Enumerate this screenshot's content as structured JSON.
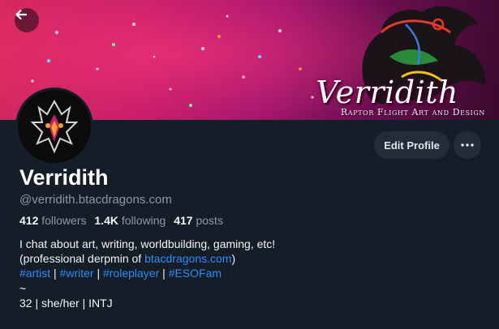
{
  "banner": {
    "title": "Verridith",
    "subtitle": "Raptor Flight Art and Design"
  },
  "buttons": {
    "edit_profile": "Edit Profile"
  },
  "profile": {
    "display_name": "Verridith",
    "handle": "@verridith.btacdragons.com",
    "stats": {
      "followers_count": "412",
      "followers_label": "followers",
      "following_count": "1.4K",
      "following_label": "following",
      "posts_count": "417",
      "posts_label": "posts"
    },
    "bio": {
      "line1": "I chat about art, writing, worldbuilding, gaming, etc!",
      "line2_prefix": "(professional derpmin of ",
      "line2_link": "btacdragons.com",
      "line2_suffix": ")",
      "hashtags": [
        "#artist",
        "#writer",
        "#roleplayer",
        "#ESOFam"
      ],
      "separator": "|",
      "line4": "~",
      "line5": "32 | she/her | INTJ"
    }
  },
  "colors": {
    "background": "#151d28",
    "link": "#2f8df5",
    "muted_text": "#8c98a6",
    "pill_bg": "#232d3a"
  },
  "icons": {
    "back": "arrow-left-icon",
    "more": "ellipsis-icon",
    "avatar": "dragon-head-icon"
  }
}
